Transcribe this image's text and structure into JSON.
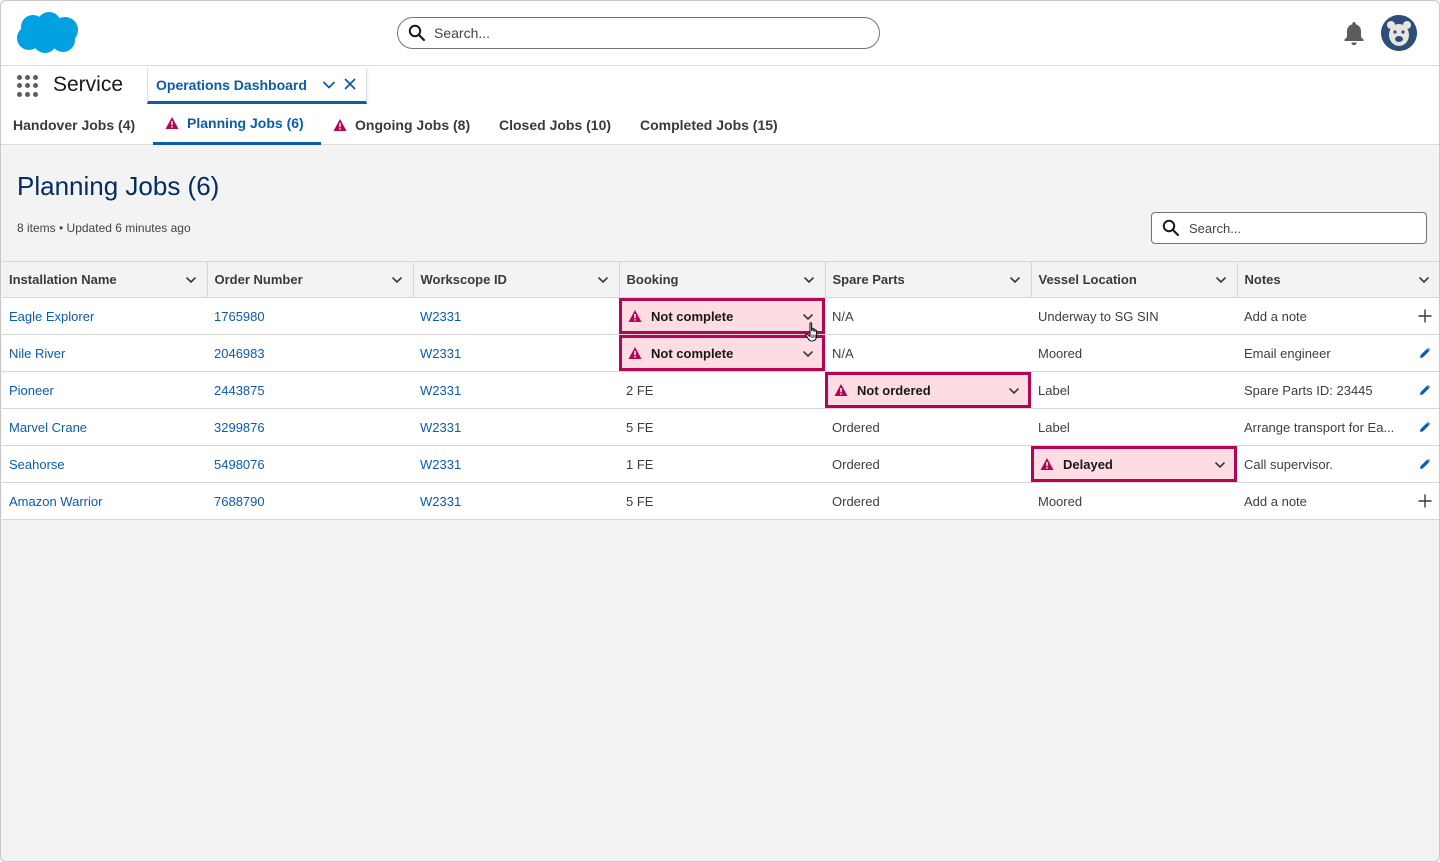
{
  "global_header": {
    "search_placeholder": "Search...",
    "icons": [
      "salesforce-cloud-logo",
      "search-icon",
      "bell-icon",
      "avatar"
    ]
  },
  "app_bar": {
    "app_name": "Service",
    "workspace_tab": "Operations Dashboard"
  },
  "subtabs": [
    {
      "label": "Handover Jobs (4)",
      "warning": false,
      "active": false
    },
    {
      "label": "Planning Jobs (6)",
      "warning": true,
      "active": true
    },
    {
      "label": "Ongoing Jobs (8)",
      "warning": true,
      "active": false
    },
    {
      "label": "Closed Jobs (10)",
      "warning": false,
      "active": false
    },
    {
      "label": "Completed Jobs (15)",
      "warning": false,
      "active": false
    }
  ],
  "list": {
    "title": "Planning Jobs (6)",
    "meta": "8 items • Updated 6 minutes ago",
    "search_placeholder": "Search..."
  },
  "table": {
    "columns": [
      "Installation Name",
      "Order Number",
      "Workscope ID",
      "Booking",
      "Spare Parts",
      "Vessel Location",
      "Notes"
    ],
    "rows": [
      {
        "installation": "Eagle Explorer",
        "order": "1765980",
        "workscope": "W2331",
        "booking": "Not complete",
        "booking_alert": true,
        "spare": "N/A",
        "spare_alert": false,
        "vessel": "Underway to SG SIN",
        "vessel_alert": false,
        "notes": "Add a note",
        "notes_action": "add"
      },
      {
        "installation": "Nile River",
        "order": "2046983",
        "workscope": "W2331",
        "booking": "Not complete",
        "booking_alert": true,
        "spare": "N/A",
        "spare_alert": false,
        "vessel": "Moored",
        "vessel_alert": false,
        "notes": "Email engineer",
        "notes_action": "edit"
      },
      {
        "installation": "Pioneer",
        "order": "2443875",
        "workscope": "W2331",
        "booking": "2 FE",
        "booking_alert": false,
        "spare": "Not ordered",
        "spare_alert": true,
        "vessel": "Label",
        "vessel_alert": false,
        "notes": "Spare Parts ID: 23445",
        "notes_action": "edit"
      },
      {
        "installation": "Marvel Crane",
        "order": "3299876",
        "workscope": "W2331",
        "booking": "5 FE",
        "booking_alert": false,
        "spare": "Ordered",
        "spare_alert": false,
        "vessel": "Label",
        "vessel_alert": false,
        "notes": "Arrange transport for Ea...",
        "notes_action": "edit"
      },
      {
        "installation": "Seahorse",
        "order": "5498076",
        "workscope": "W2331",
        "booking": "1 FE",
        "booking_alert": false,
        "spare": "Ordered",
        "spare_alert": false,
        "vessel": "Delayed",
        "vessel_alert": true,
        "notes": "Call supervisor.",
        "notes_action": "edit"
      },
      {
        "installation": "Amazon Warrior",
        "order": "7688790",
        "workscope": "W2331",
        "booking": "5 FE",
        "booking_alert": false,
        "spare": "Ordered",
        "spare_alert": false,
        "vessel": "Moored",
        "vessel_alert": false,
        "notes": "Add a note",
        "notes_action": "add"
      }
    ]
  },
  "colors": {
    "brand_blue": "#0b5cab",
    "title_navy": "#032d60",
    "alert_border": "#b60554",
    "alert_fill": "#fddde3",
    "logo_blue": "#00a1e0"
  }
}
